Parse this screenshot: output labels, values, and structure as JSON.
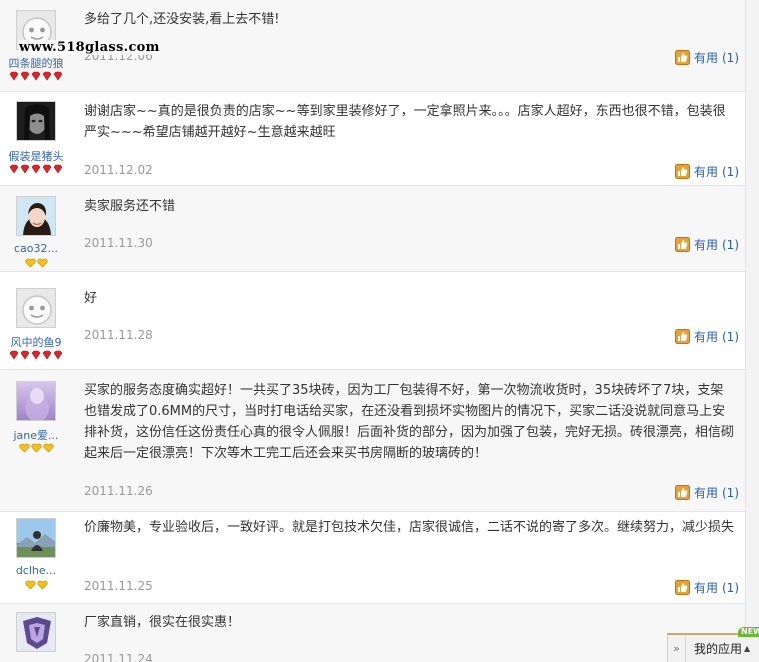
{
  "watermark": "www.518glass.com",
  "useful_label": "有用",
  "reviews": [
    {
      "user": "四条腿的狼",
      "avatar": "default-face-icon",
      "rank_icon": "red-diamond-icon",
      "rank_count": 5,
      "text": "多给了几个,还没安装,看上去不错!",
      "date": "2011.12.06",
      "useful_count": "(1)"
    },
    {
      "user": "假装是猪头",
      "avatar": "user-photo-dark",
      "rank_icon": "red-diamond-icon",
      "rank_count": 5,
      "text": "谢谢店家~~真的是很负责的店家~~等到家里装修好了，一定拿照片来。。。店家人超好，东西也很不错，包装很严实~~~希望店铺越开越好~生意越来越旺",
      "date": "2011.12.02",
      "useful_count": "(1)"
    },
    {
      "user": "cao32...",
      "avatar": "user-photo-girl",
      "rank_icon": "yellow-heart-icon",
      "rank_count": 2,
      "text": "卖家服务还不错",
      "date": "2011.11.30",
      "useful_count": "(1)"
    },
    {
      "user": "风中的鱼9",
      "avatar": "default-face-icon",
      "rank_icon": "red-diamond-icon",
      "rank_count": 5,
      "text": "好",
      "date": "2011.11.28",
      "useful_count": "(1)"
    },
    {
      "user": "jane爱...",
      "avatar": "user-photo-purple",
      "rank_icon": "yellow-heart-icon",
      "rank_count": 3,
      "text": "买家的服务态度确实超好！一共买了35块砖，因为工厂包装得不好，第一次物流收货时，35块砖坏了7块，支架也错发成了0.6MM的尺寸，当时打电话给买家，在还没看到损坏实物图片的情况下，买家二话没说就同意马上安排补货，这份信任这份责任心真的很令人佩服！后面补货的部分，因为加强了包装，完好无损。砖很漂亮，相信砌起来后一定很漂亮！下次等木工完工后还会来买书房隔断的玻璃砖的！",
      "date": "2011.11.26",
      "useful_count": "(1)"
    },
    {
      "user": "dclhe...",
      "avatar": "user-photo-landscape",
      "rank_icon": "yellow-heart-icon",
      "rank_count": 2,
      "text": "价廉物美，专业验收后，一致好评。就是打包技术欠佳，店家很诚信，二话不说的寄了多次。继续努力，减少损失",
      "date": "2011.11.25",
      "useful_count": "(1)"
    },
    {
      "user": "",
      "avatar": "user-photo-logo",
      "rank_icon": "",
      "rank_count": 0,
      "text": "厂家直销，很实在很实惠！",
      "date": "2011.11.24",
      "useful_count": ""
    }
  ],
  "app_bar": {
    "label": "我的应用",
    "badge": "NEW"
  },
  "colors": {
    "link_blue": "#2a5ea8",
    "date_gray": "#999999",
    "row_alt": "#f7f7f7",
    "diamond_red": "#d9262c",
    "heart_yellow": "#e8b400"
  }
}
